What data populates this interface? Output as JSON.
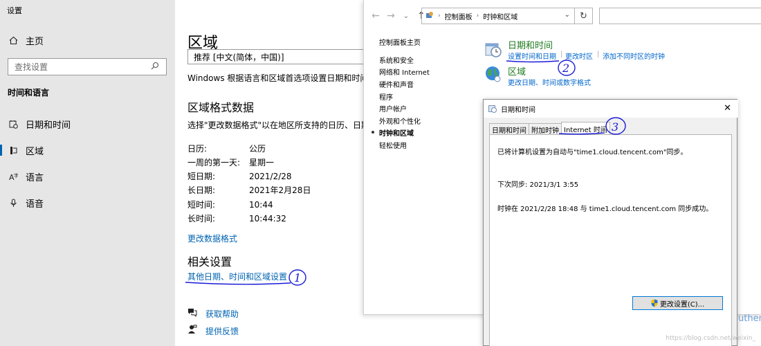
{
  "settings": {
    "app_title": "设置",
    "home": "主页",
    "search_placeholder": "查找设置",
    "section": "时间和语言",
    "nav": [
      "日期和时间",
      "区域",
      "语言",
      "语音"
    ],
    "page_title": "区域",
    "region_value": "推荐 [中文(简体，中国)]",
    "description": "Windows 根据语言和区域首选项设置日期和时间的格式",
    "format_title": "区域格式数据",
    "format_desc": "选择\"更改数据格式\"以在地区所支持的日历、日期和时间格式之间切换",
    "format_rows": [
      {
        "k": "日历:",
        "v": "公历"
      },
      {
        "k": "一周的第一天:",
        "v": "星期一"
      },
      {
        "k": "短日期:",
        "v": "2021/2/28"
      },
      {
        "k": "长日期:",
        "v": "2021年2月28日"
      },
      {
        "k": "短时间:",
        "v": "10:44"
      },
      {
        "k": "长时间:",
        "v": "10:44:32"
      }
    ],
    "change_format_link": "更改数据格式",
    "related_title": "相关设置",
    "related_link": "其他日期、时间和区域设置",
    "get_help": "获取帮助",
    "feedback": "提供反馈"
  },
  "control_panel": {
    "breadcrumbs": [
      "控制面板",
      "时钟和区域"
    ],
    "left_links": [
      "控制面板主页",
      "系统和安全",
      "网络和 Internet",
      "硬件和声音",
      "程序",
      "用户帐户",
      "外观和个性化",
      "时钟和区域",
      "轻松使用"
    ],
    "current_left": "时钟和区域",
    "categories": [
      {
        "title": "日期和时间",
        "links": [
          "设置时间和日期",
          "更改时区",
          "添加不同时区的时钟"
        ]
      },
      {
        "title": "区域",
        "links": [
          "更改日期、时间或数字格式"
        ]
      }
    ]
  },
  "dialog": {
    "title": "日期和时间",
    "tabs": [
      "日期和时间",
      "附加时钟",
      "Internet 时间"
    ],
    "active_tab": "Internet 时间",
    "sync_info": "已将计算机设置为自动与\"time1.cloud.tencent.com\"同步。",
    "next_sync": "下次同步: 2021/3/1 3:55",
    "last_sync": "时钟在 2021/2/28 18:48 与 time1.cloud.tencent.com 同步成功。",
    "change_button": "更改设置(C)..."
  },
  "annotations": [
    "1",
    "2",
    "3"
  ],
  "partial_text": "uthent",
  "watermark": "https://blog.csdn.net/weixin_",
  "colors": {
    "accent": "#0063b1",
    "cp_green": "#1e7b1e",
    "cp_link": "#0066cc",
    "ink": "#1a1ad6"
  }
}
